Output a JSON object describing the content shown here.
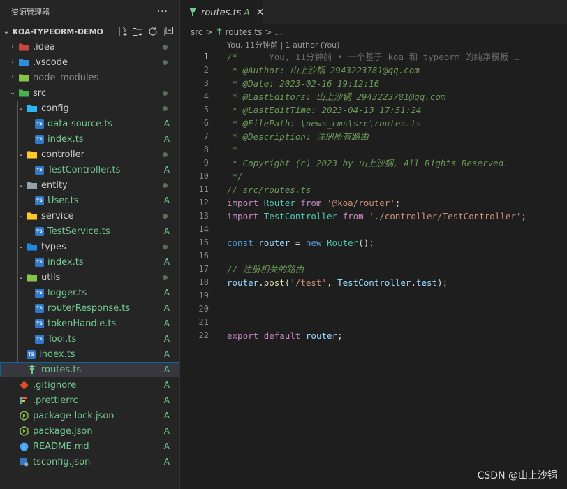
{
  "sidebar": {
    "title": "资源管理器",
    "more": "···",
    "project": "KOA-TYPEORM-DEMO",
    "tree": [
      {
        "label": ".idea",
        "type": "folder",
        "depth": 0,
        "open": false,
        "icon": "idea-folder-icon",
        "color": "#c5483f",
        "status": "",
        "dot": true,
        "dim": false
      },
      {
        "label": ".vscode",
        "type": "folder",
        "depth": 0,
        "open": false,
        "icon": "vscode-folder-icon",
        "color": "#2d8fdc",
        "status": "",
        "dot": true,
        "dim": false
      },
      {
        "label": "node_modules",
        "type": "folder",
        "depth": 0,
        "open": false,
        "icon": "node-folder-icon",
        "color": "#8bc34a",
        "status": "",
        "dot": false,
        "dim": true
      },
      {
        "label": "src",
        "type": "folder",
        "depth": 0,
        "open": true,
        "icon": "src-folder-icon",
        "color": "#4caf50",
        "status": "",
        "dot": true,
        "dim": false
      },
      {
        "label": "config",
        "type": "folder",
        "depth": 1,
        "open": true,
        "icon": "config-folder-icon",
        "color": "#29b6f6",
        "status": "",
        "dot": true,
        "dim": false
      },
      {
        "label": "data-source.ts",
        "type": "ts",
        "depth": 2,
        "status": "A",
        "dot": false,
        "dim": false
      },
      {
        "label": "index.ts",
        "type": "ts",
        "depth": 2,
        "status": "A",
        "dot": false,
        "dim": false
      },
      {
        "label": "controller",
        "type": "folder",
        "depth": 1,
        "open": true,
        "icon": "controller-folder-icon",
        "color": "#ffca28",
        "status": "",
        "dot": true,
        "dim": false
      },
      {
        "label": "TestController.ts",
        "type": "ts",
        "depth": 2,
        "status": "A",
        "dot": false,
        "dim": false
      },
      {
        "label": "entity",
        "type": "folder",
        "depth": 1,
        "open": true,
        "icon": "entity-folder-icon",
        "color": "#90a4ae",
        "status": "",
        "dot": true,
        "dim": false
      },
      {
        "label": "User.ts",
        "type": "ts",
        "depth": 2,
        "status": "A",
        "dot": false,
        "dim": false
      },
      {
        "label": "service",
        "type": "folder",
        "depth": 1,
        "open": true,
        "icon": "service-folder-icon",
        "color": "#ffca28",
        "status": "",
        "dot": true,
        "dim": false
      },
      {
        "label": "TestService.ts",
        "type": "ts",
        "depth": 2,
        "status": "A",
        "dot": false,
        "dim": false
      },
      {
        "label": "types",
        "type": "folder",
        "depth": 1,
        "open": true,
        "icon": "types-folder-icon",
        "color": "#1e88e5",
        "status": "",
        "dot": true,
        "dim": false
      },
      {
        "label": "index.ts",
        "type": "ts",
        "depth": 2,
        "status": "A",
        "dot": false,
        "dim": false
      },
      {
        "label": "utils",
        "type": "folder",
        "depth": 1,
        "open": true,
        "icon": "utils-folder-icon",
        "color": "#8bc34a",
        "status": "",
        "dot": true,
        "dim": false
      },
      {
        "label": "logger.ts",
        "type": "ts",
        "depth": 2,
        "status": "A",
        "dot": false,
        "dim": false
      },
      {
        "label": "routerResponse.ts",
        "type": "ts",
        "depth": 2,
        "status": "A",
        "dot": false,
        "dim": false
      },
      {
        "label": "tokenHandle.ts",
        "type": "ts",
        "depth": 2,
        "status": "A",
        "dot": false,
        "dim": false
      },
      {
        "label": "Tool.ts",
        "type": "ts",
        "depth": 2,
        "status": "A",
        "dot": false,
        "dim": false
      },
      {
        "label": "index.ts",
        "type": "ts",
        "depth": 1,
        "status": "A",
        "dot": false,
        "dim": false
      },
      {
        "label": "routes.ts",
        "type": "routes",
        "depth": 1,
        "status": "A",
        "dot": false,
        "dim": false,
        "selected": true
      },
      {
        "label": ".gitignore",
        "type": "git",
        "depth": 0,
        "status": "A",
        "dot": false,
        "dim": false
      },
      {
        "label": ".prettierrc",
        "type": "prettier",
        "depth": 0,
        "status": "A",
        "dot": false,
        "dim": false
      },
      {
        "label": "package-lock.json",
        "type": "npm",
        "depth": 0,
        "status": "A",
        "dot": false,
        "dim": false
      },
      {
        "label": "package.json",
        "type": "npm",
        "depth": 0,
        "status": "A",
        "dot": false,
        "dim": false
      },
      {
        "label": "README.md",
        "type": "info",
        "depth": 0,
        "status": "A",
        "dot": false,
        "dim": false
      },
      {
        "label": "tsconfig.json",
        "type": "tsconfig",
        "depth": 0,
        "status": "A",
        "dot": false,
        "dim": false
      }
    ]
  },
  "tab": {
    "name": "routes.ts",
    "status": "A",
    "close": "✕"
  },
  "breadcrumb": {
    "folder": "src",
    "sep": ">",
    "file": "routes.ts",
    "more": "..."
  },
  "blame": "You, 11分钟前 | 1 author (You)",
  "lines": [
    {
      "n": "1",
      "html": "<span class='c'>/*</span><span class='gh'>      You, 11分钟前 • 一个基于 koa 和 typeorm 的纯净模板 …</span>"
    },
    {
      "n": "2",
      "html": "<span class='c'> * @Author: 山上沙锅 2943223781@qq.com</span>"
    },
    {
      "n": "3",
      "html": "<span class='c'> * @Date: 2023-02-16 19:12:16</span>"
    },
    {
      "n": "4",
      "html": "<span class='c'> * @LastEditors: 山上沙锅 2943223781@qq.com</span>"
    },
    {
      "n": "5",
      "html": "<span class='c'> * @LastEditTime: 2023-04-13 17:51:24</span>"
    },
    {
      "n": "6",
      "html": "<span class='c'> * @FilePath: \\news_cms\\src\\routes.ts</span>"
    },
    {
      "n": "7",
      "html": "<span class='c'> * @Description: 注册所有路由</span>"
    },
    {
      "n": "8",
      "html": "<span class='c'> *</span>"
    },
    {
      "n": "9",
      "html": "<span class='c'> * Copyright (c) 2023 by 山上沙锅, All Rights Reserved.</span>"
    },
    {
      "n": "10",
      "html": "<span class='c'> */</span>"
    },
    {
      "n": "11",
      "html": "<span class='c'>// src/routes.ts</span>"
    },
    {
      "n": "12",
      "html": "<span class='k'>import</span> <span class='t'>Router</span> <span class='k'>from</span> <span class='s'>'@koa/router'</span><span class='o'>;</span>"
    },
    {
      "n": "13",
      "html": "<span class='k'>import</span> <span class='t'>TestController</span> <span class='k'>from</span> <span class='s'>'./controller/TestController'</span><span class='o'>;</span>"
    },
    {
      "n": "14",
      "html": ""
    },
    {
      "n": "15",
      "html": "<span class='k2'>const</span> <span class='v'>router</span> <span class='o'>=</span> <span class='k2'>new</span> <span class='t'>Router</span><span class='o'>();</span>"
    },
    {
      "n": "16",
      "html": ""
    },
    {
      "n": "17",
      "html": "<span class='c'>// 注册相关的路由</span>"
    },
    {
      "n": "18",
      "html": "<span class='v'>router</span><span class='o'>.</span><span class='f'>post</span><span class='o'>(</span><span class='s'>'/test'</span><span class='o'>, </span><span class='v'>TestController</span><span class='o'>.</span><span class='v'>test</span><span class='o'>);</span>"
    },
    {
      "n": "19",
      "html": ""
    },
    {
      "n": "20",
      "html": ""
    },
    {
      "n": "21",
      "html": ""
    },
    {
      "n": "22",
      "html": "<span class='k'>export</span> <span class='k'>default</span> <span class='v'>router</span><span class='o'>;</span>"
    }
  ],
  "watermark": "CSDN @山上沙锅",
  "colors": {
    "accent": "#0e639c",
    "added": "#73c991",
    "comment": "#6a9955"
  }
}
